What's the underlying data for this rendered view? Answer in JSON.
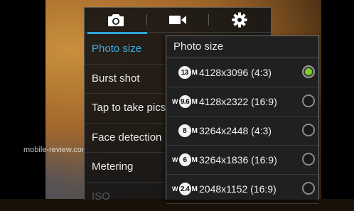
{
  "tabs": [
    {
      "icon": "camera-icon"
    },
    {
      "icon": "video-icon"
    },
    {
      "icon": "gear-icon"
    }
  ],
  "menu": {
    "items": [
      {
        "label": "Photo size"
      },
      {
        "label": "Burst shot"
      },
      {
        "label": "Tap to take pics"
      },
      {
        "label": "Face detection"
      },
      {
        "label": "Metering"
      },
      {
        "label": "ISO"
      }
    ],
    "active_index": 0
  },
  "submenu": {
    "title": "Photo size",
    "options": [
      {
        "badge": "13",
        "wide": false,
        "label": "4128x3096 (4:3)",
        "selected": true
      },
      {
        "badge": "9.6",
        "wide": true,
        "label": "4128x2322 (16:9)",
        "selected": false
      },
      {
        "badge": "8",
        "wide": false,
        "label": "3264x2448 (4:3)",
        "selected": false
      },
      {
        "badge": "6",
        "wide": true,
        "label": "3264x1836 (16:9)",
        "selected": false
      },
      {
        "badge": "2.4",
        "wide": true,
        "label": "2048x1152 (16:9)",
        "selected": false
      }
    ]
  },
  "watermark": "mobile-review.com",
  "colors": {
    "accent": "#2ea4d8",
    "selected_radio": "#7cd11f"
  }
}
